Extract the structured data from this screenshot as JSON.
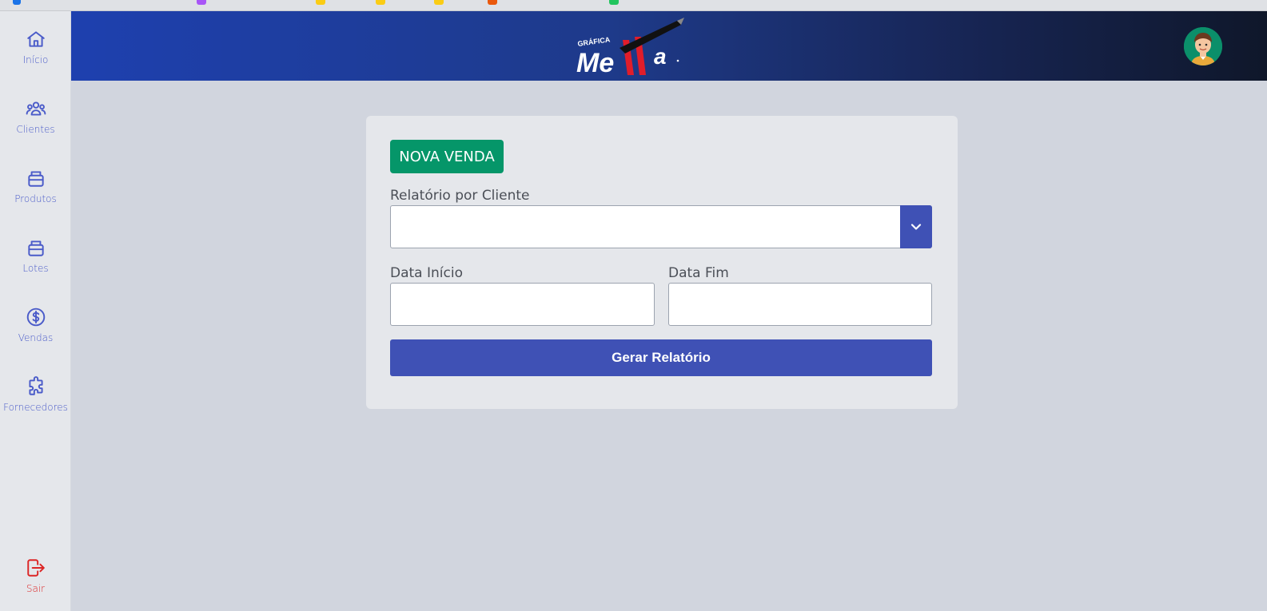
{
  "sidebar": {
    "items": [
      {
        "label": "Início",
        "icon": "home-icon"
      },
      {
        "label": "Clientes",
        "icon": "users-icon"
      },
      {
        "label": "Produtos",
        "icon": "box-icon"
      },
      {
        "label": "Lotes",
        "icon": "box-icon"
      },
      {
        "label": "Vendas",
        "icon": "dollar-circle-icon"
      },
      {
        "label": "Fornecedores",
        "icon": "puzzle-icon"
      }
    ],
    "logout": {
      "label": "Sair",
      "icon": "logout-icon"
    }
  },
  "header": {
    "logo_small": "GRÁFICA",
    "logo_main": "Me",
    "logo_tail": "a"
  },
  "form": {
    "new_sale_label": "NOVA VENDA",
    "client_report_label": "Relatório por Cliente",
    "start_date_label": "Data Início",
    "end_date_label": "Data Fim",
    "generate_label": "Gerar Relatório"
  },
  "colors": {
    "accent": "#3f51b5",
    "success": "#059669",
    "nav": "#4a5bc9",
    "danger": "#dc2626"
  }
}
